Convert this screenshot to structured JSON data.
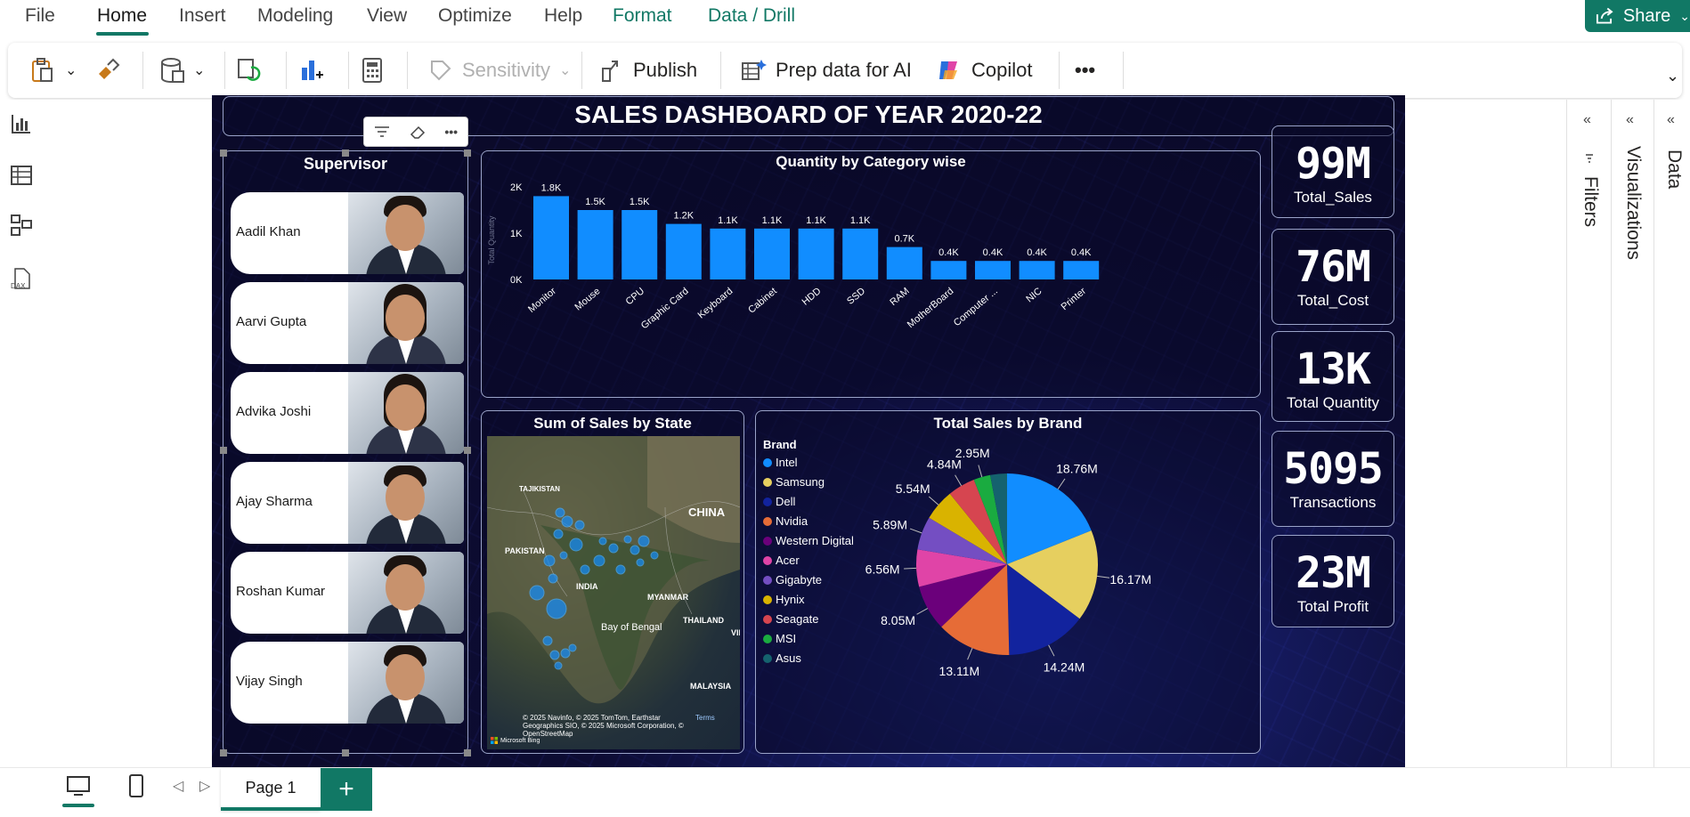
{
  "menu": {
    "file": "File",
    "home": "Home",
    "insert": "Insert",
    "modeling": "Modeling",
    "view": "View",
    "optimize": "Optimize",
    "help": "Help",
    "format": "Format",
    "data_drill": "Data / Drill"
  },
  "share": {
    "label": "Share"
  },
  "ribbon": {
    "sensitivity": "Sensitivity",
    "publish": "Publish",
    "prep_data": "Prep data for AI",
    "copilot": "Copilot",
    "more": "•••"
  },
  "report": {
    "title": "SALES DASHBOARD OF YEAR 2020-22",
    "supervisor_title": "Supervisor",
    "supervisors": [
      "Aadil Khan",
      "Aarvi Gupta",
      "Advika Joshi",
      "Ajay Sharma",
      "Roshan Kumar",
      "Vijay Singh"
    ],
    "kpis": [
      {
        "value": "99M",
        "label": "Total_Sales"
      },
      {
        "value": "76M",
        "label": "Total_Cost"
      },
      {
        "value": "13K",
        "label": "Total Quantity"
      },
      {
        "value": "5095",
        "label": "Transactions"
      },
      {
        "value": "23M",
        "label": "Total Profit"
      }
    ],
    "map": {
      "title": "Sum of Sales by State",
      "labels": [
        "TAJIKISTAN",
        "CHINA",
        "PAKISTAN",
        "INDIA",
        "MYANMAR",
        "THAILAND",
        "Bay of Bengal",
        "MALAYSIA",
        "VIE"
      ],
      "attribution": "© 2025 Navinfo, © 2025 TomTom, Earthstar Geographics SIO, © 2025 Microsoft Corporation, © OpenStreetMap",
      "terms": "Terms",
      "bing": "Microsoft Bing"
    }
  },
  "chart_data": [
    {
      "type": "bar",
      "title": "Quantity by Category wise",
      "ylabel": "Total Quantity",
      "categories": [
        "Monitor",
        "Mouse",
        "CPU",
        "Graphic Card",
        "Keyboard",
        "Cabinet",
        "HDD",
        "SSD",
        "RAM",
        "MotherBoard",
        "Computer ...",
        "NIC",
        "Printer"
      ],
      "values": [
        1800,
        1500,
        1500,
        1200,
        1100,
        1100,
        1100,
        1100,
        700,
        400,
        400,
        400,
        400
      ],
      "data_labels": [
        "1.8K",
        "1.5K",
        "1.5K",
        "1.2K",
        "1.1K",
        "1.1K",
        "1.1K",
        "1.1K",
        "0.7K",
        "0.4K",
        "0.4K",
        "0.4K",
        "0.4K"
      ],
      "yticks": [
        "0K",
        "1K",
        "2K"
      ],
      "ylim": [
        0,
        2000
      ],
      "color": "#118dff"
    },
    {
      "type": "pie",
      "title": "Total Sales by Brand",
      "legend_title": "Brand",
      "labels": [
        "Intel",
        "Samsung",
        "Dell",
        "Nvidia",
        "Western Digital",
        "Acer",
        "Gigabyte",
        "Hynix",
        "Seagate",
        "MSI",
        "Asus"
      ],
      "values": [
        18.76,
        16.17,
        14.24,
        13.11,
        8.05,
        6.56,
        5.89,
        5.54,
        4.84,
        2.95,
        2.95
      ],
      "data_labels": [
        "18.76M",
        "16.17M",
        "14.24M",
        "13.11M",
        "8.05M",
        "6.56M",
        "5.89M",
        "5.54M",
        "4.84M",
        "2.95M",
        ""
      ],
      "colors": [
        "#118dff",
        "#e6cf5f",
        "#12239e",
        "#e66c37",
        "#6b007b",
        "#e044a7",
        "#744ec2",
        "#d9b300",
        "#d64550",
        "#1aab40",
        "#15626e"
      ]
    }
  ],
  "pages": {
    "page1": "Page 1",
    "add": "+"
  },
  "panes": {
    "data": "Data",
    "visualizations": "Visualizations",
    "filters": "Filters"
  }
}
